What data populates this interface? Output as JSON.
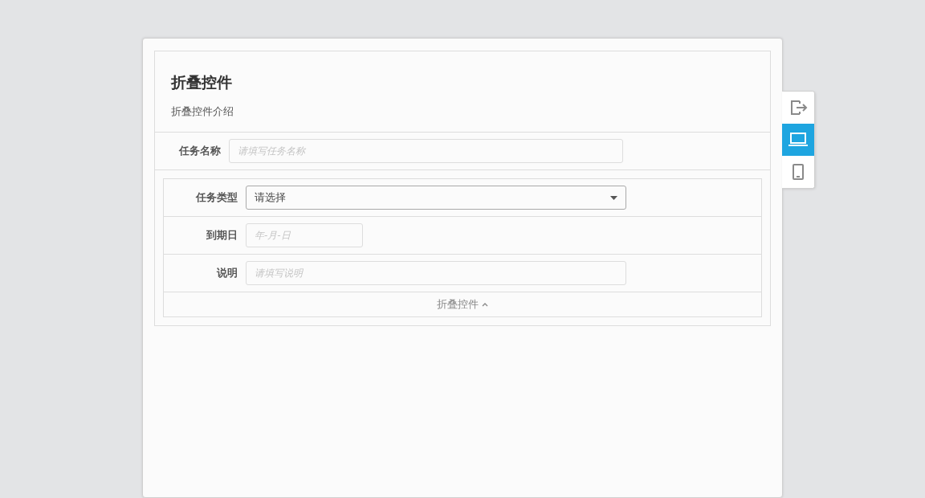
{
  "header": {
    "title": "折叠控件",
    "subtitle": "折叠控件介绍"
  },
  "fields": [
    {
      "kind": "text",
      "label": "任务名称",
      "placeholder": "请填写任务名称"
    }
  ],
  "collapse": {
    "expanded": true,
    "toggle_label": "折叠控件",
    "fields": [
      {
        "kind": "select",
        "label": "任务类型",
        "value": "请选择"
      },
      {
        "kind": "date",
        "label": "到期日",
        "placeholder": "年-月-日"
      },
      {
        "kind": "text",
        "label": "说明",
        "placeholder": "请填写说明"
      }
    ]
  },
  "device_toolbar": [
    {
      "kind": "exit",
      "selected": false
    },
    {
      "kind": "desktop",
      "selected": true
    },
    {
      "kind": "mobile",
      "selected": false
    }
  ]
}
